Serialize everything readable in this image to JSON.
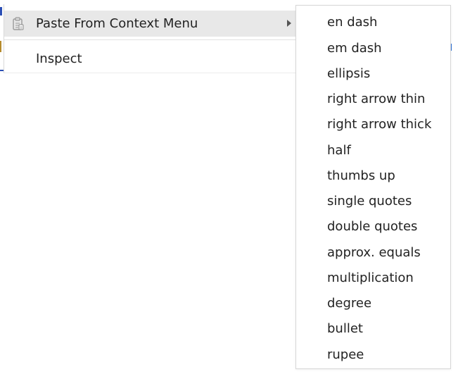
{
  "context_menu": {
    "items": [
      {
        "label": "Paste From Context Menu",
        "icon": "clipboard-icon",
        "has_submenu": true,
        "highlighted": true
      },
      {
        "label": "Inspect",
        "icon": null,
        "has_submenu": false,
        "highlighted": false
      }
    ]
  },
  "submenu": {
    "items": [
      {
        "label": "en dash"
      },
      {
        "label": "em dash"
      },
      {
        "label": "ellipsis"
      },
      {
        "label": "right arrow thin"
      },
      {
        "label": "right arrow thick"
      },
      {
        "label": "half"
      },
      {
        "label": "thumbs up"
      },
      {
        "label": "single quotes"
      },
      {
        "label": "double quotes"
      },
      {
        "label": "approx. equals"
      },
      {
        "label": "multiplication"
      },
      {
        "label": "degree"
      },
      {
        "label": "bullet"
      },
      {
        "label": "rupee"
      }
    ]
  },
  "colors": {
    "highlight": "#e8e8e8",
    "menu_background": "#ffffff",
    "text": "#222222",
    "border": "#d6d6d6"
  }
}
